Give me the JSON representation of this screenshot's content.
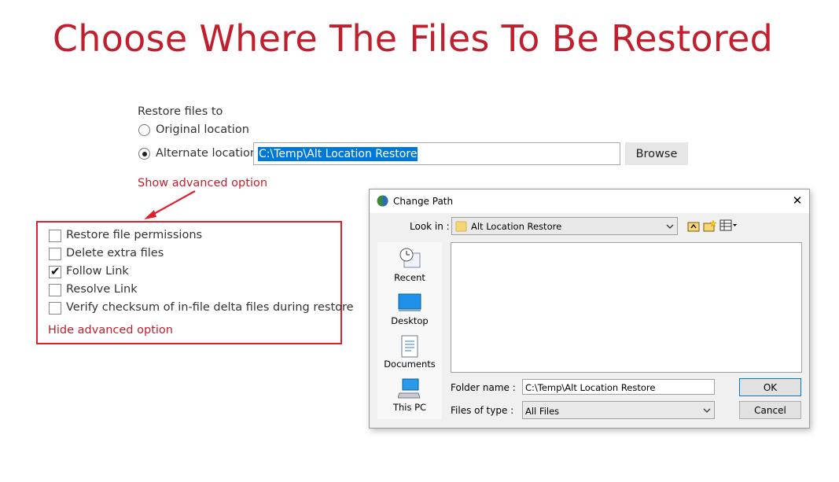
{
  "title": "Choose Where The Files To Be Restored",
  "restore": {
    "heading": "Restore files to",
    "original_label": "Original location",
    "alternate_label": "Alternate location",
    "alternate_selected": true,
    "path_value": "C:\\Temp\\Alt Location Restore",
    "browse_label": "Browse",
    "show_advanced": "Show advanced option"
  },
  "advanced": {
    "options": [
      {
        "label": "Restore file permissions",
        "checked": false
      },
      {
        "label": "Delete extra files",
        "checked": false
      },
      {
        "label": "Follow Link",
        "checked": true
      },
      {
        "label": "Resolve Link",
        "checked": false
      },
      {
        "label": "Verify checksum of in-file delta files during restore",
        "checked": false
      }
    ],
    "hide_advanced": "Hide advanced option"
  },
  "dialog": {
    "title": "Change Path",
    "look_in_label": "Look in :",
    "look_in_value": "Alt Location Restore",
    "places": [
      "Recent",
      "Desktop",
      "Documents",
      "This PC"
    ],
    "folder_name_label": "Folder name :",
    "folder_name_value": "C:\\Temp\\Alt Location Restore",
    "files_of_type_label": "Files of type :",
    "files_of_type_value": "All Files",
    "ok_label": "OK",
    "cancel_label": "Cancel",
    "close_glyph": "✕"
  },
  "colors": {
    "brand_red": "#c0202e",
    "selection_blue": "#0078d7"
  }
}
